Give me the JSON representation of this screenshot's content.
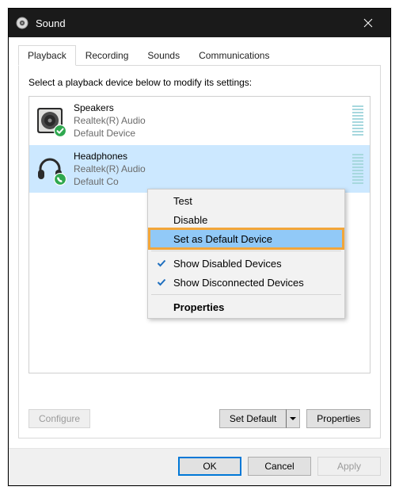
{
  "window": {
    "title": "Sound",
    "close_label": "Close"
  },
  "tabs": [
    "Playback",
    "Recording",
    "Sounds",
    "Communications"
  ],
  "active_tab_index": 0,
  "instruction": "Select a playback device below to modify its settings:",
  "devices": [
    {
      "name": "Speakers",
      "driver": "Realtek(R) Audio",
      "status": "Default Device",
      "selected": false,
      "icon": "speaker"
    },
    {
      "name": "Headphones",
      "driver": "Realtek(R) Audio",
      "status": "Default Co",
      "selected": true,
      "icon": "headphones"
    }
  ],
  "context_menu": {
    "items": [
      {
        "label": "Test"
      },
      {
        "label": "Disable"
      },
      {
        "label": "Set as Default Device",
        "highlighted": true
      },
      {
        "sep": true
      },
      {
        "label": "Show Disabled Devices",
        "checked": true
      },
      {
        "label": "Show Disconnected Devices",
        "checked": true
      },
      {
        "sep": true
      },
      {
        "label": "Properties",
        "bold": true
      }
    ]
  },
  "buttons": {
    "configure": "Configure",
    "set_default": "Set Default",
    "properties": "Properties",
    "ok": "OK",
    "cancel": "Cancel",
    "apply": "Apply"
  }
}
